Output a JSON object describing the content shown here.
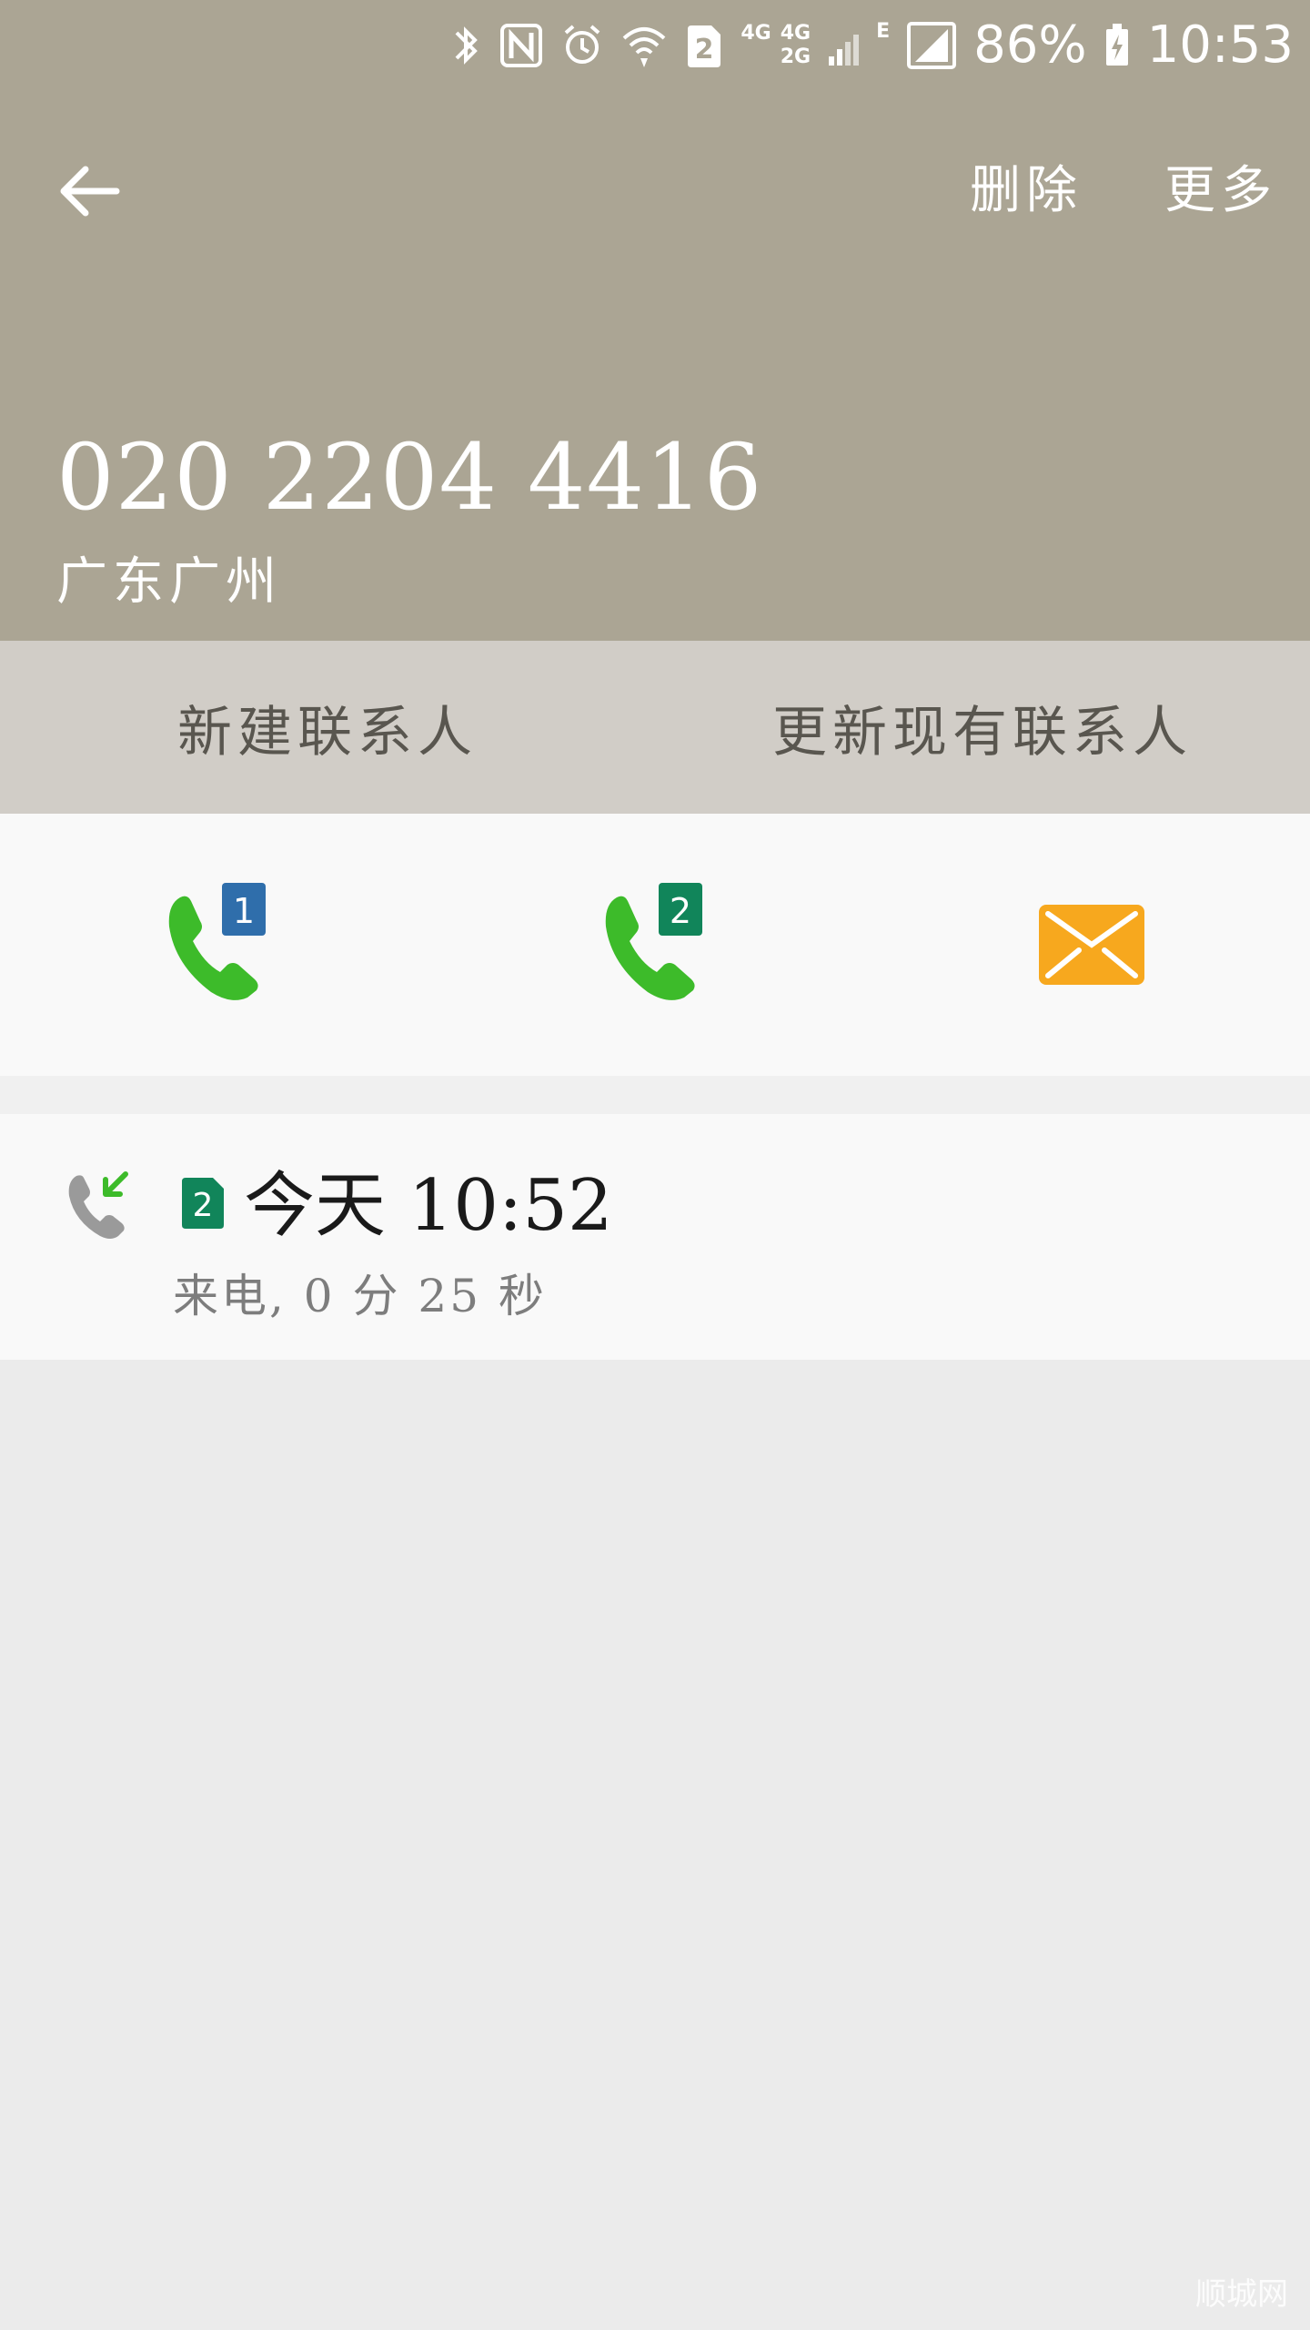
{
  "status_bar": {
    "icons": [
      "bluetooth-icon",
      "nfc-icon",
      "alarm-icon",
      "wifi-icon",
      "sim2-icon",
      "signal-icon",
      "battery-icon"
    ],
    "network_labels": [
      "4G",
      "4G",
      "2G",
      "E"
    ],
    "sim_label": "2",
    "battery": "86%",
    "time": "10:53"
  },
  "toolbar": {
    "delete_label": "删除",
    "more_label": "更多"
  },
  "contact": {
    "number": "020 2204 4416",
    "location": "广东广州"
  },
  "contact_actions": {
    "new_contact": "新建联系人",
    "update_contact": "更新现有联系人"
  },
  "quick_actions": {
    "call_sim1_badge": "1",
    "call_sim2_badge": "2"
  },
  "call_log": [
    {
      "sim": "2",
      "time": "今天 10:52",
      "detail": "来电, 0 分 25 秒"
    }
  ],
  "watermark": "顺城网",
  "colors": {
    "header_bg": "#aba594",
    "contact_bar_bg": "#d1cdc7",
    "call_green": "#3dbb2a",
    "sim1_blue": "#2f6eab",
    "sim2_green": "#11855a",
    "message_orange": "#f7a81e"
  }
}
